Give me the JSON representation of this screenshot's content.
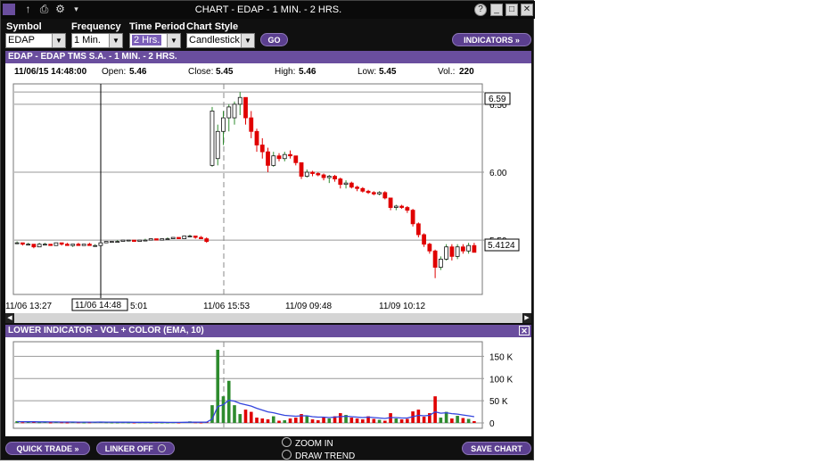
{
  "window": {
    "title": "CHART - EDAP - 1 MIN. - 2 HRS."
  },
  "toolbar": {
    "symbol_label": "Symbol",
    "symbol_value": "EDAP",
    "frequency_label": "Frequency",
    "frequency_value": "1 Min.",
    "period_label": "Time Period",
    "period_value": "2 Hrs.",
    "style_label": "Chart Style",
    "style_value": "Candlestick",
    "go_label": "GO",
    "indicators_label": "INDICATORS »"
  },
  "chart_header": "EDAP - EDAP TMS S.A. - 1 MIN. - 2 HRS.",
  "info_bar": {
    "datetime": "11/06/15 14:48:00",
    "open_label": "Open:",
    "open_value": "5.46",
    "close_label": "Close:",
    "close_value": "5.45",
    "high_label": "High:",
    "high_value": "5.46",
    "low_label": "Low:",
    "low_value": "5.45",
    "vol_label": "Vol.:",
    "vol_value": "220"
  },
  "price_chart": {
    "y_ticks": [
      "6.50",
      "6.00",
      "5.50"
    ],
    "tick_values": [
      6.5,
      6.0,
      5.5
    ],
    "high_marker": "6.59",
    "last_marker": "5.4124",
    "x_labels": [
      "11/06 13:27",
      "5:01",
      "11/06 15:53",
      "11/09 09:48",
      "11/09 10:12"
    ],
    "crosshair_label": "11/06 14:48",
    "colors": {
      "up": "#2e8b2e",
      "down": "#e00000"
    }
  },
  "lower_indicator": {
    "header": "LOWER INDICATOR - VOL + COLOR (EMA, 10)",
    "y_ticks": [
      "150 K",
      "100 K",
      "50 K",
      "0"
    ],
    "ema_color": "#3344dd"
  },
  "footer": {
    "quick_trade": "QUICK TRADE »",
    "linker": "LINKER OFF",
    "zoom_in": "ZOOM IN",
    "draw_trend": "DRAW TREND",
    "save_chart": "SAVE CHART"
  },
  "chart_data": [
    {
      "type": "candlestick",
      "title": "EDAP - EDAP TMS S.A. - 1 MIN. - 2 HRS.",
      "ylim": [
        5.1,
        6.65
      ],
      "candles": [
        [
          5.48,
          5.49,
          5.47,
          5.48
        ],
        [
          5.48,
          5.48,
          5.46,
          5.47
        ],
        [
          5.47,
          5.48,
          5.46,
          5.47
        ],
        [
          5.47,
          5.47,
          5.44,
          5.45
        ],
        [
          5.45,
          5.48,
          5.45,
          5.47
        ],
        [
          5.47,
          5.48,
          5.46,
          5.47
        ],
        [
          5.47,
          5.47,
          5.46,
          5.46
        ],
        [
          5.46,
          5.48,
          5.46,
          5.48
        ],
        [
          5.48,
          5.48,
          5.46,
          5.47
        ],
        [
          5.47,
          5.48,
          5.46,
          5.46
        ],
        [
          5.46,
          5.47,
          5.45,
          5.47
        ],
        [
          5.47,
          5.48,
          5.46,
          5.46
        ],
        [
          5.46,
          5.47,
          5.46,
          5.47
        ],
        [
          5.47,
          5.48,
          5.46,
          5.46
        ],
        [
          5.46,
          5.47,
          5.45,
          5.46
        ],
        [
          5.46,
          5.48,
          5.46,
          5.48
        ],
        [
          5.48,
          5.49,
          5.48,
          5.49
        ],
        [
          5.49,
          5.49,
          5.48,
          5.49
        ],
        [
          5.49,
          5.5,
          5.49,
          5.49
        ],
        [
          5.49,
          5.5,
          5.49,
          5.5
        ],
        [
          5.5,
          5.5,
          5.49,
          5.5
        ],
        [
          5.5,
          5.5,
          5.49,
          5.49
        ],
        [
          5.49,
          5.5,
          5.49,
          5.5
        ],
        [
          5.5,
          5.51,
          5.5,
          5.5
        ],
        [
          5.5,
          5.51,
          5.5,
          5.51
        ],
        [
          5.51,
          5.51,
          5.5,
          5.5
        ],
        [
          5.5,
          5.51,
          5.5,
          5.51
        ],
        [
          5.51,
          5.52,
          5.51,
          5.51
        ],
        [
          5.51,
          5.52,
          5.51,
          5.52
        ],
        [
          5.52,
          5.52,
          5.51,
          5.51
        ],
        [
          5.51,
          5.53,
          5.51,
          5.53
        ],
        [
          5.53,
          5.54,
          5.52,
          5.53
        ],
        [
          5.53,
          5.53,
          5.51,
          5.52
        ],
        [
          5.52,
          5.53,
          5.51,
          5.51
        ],
        [
          5.51,
          5.52,
          5.48,
          5.49
        ],
        [
          6.05,
          6.48,
          6.04,
          6.45
        ],
        [
          6.1,
          6.35,
          6.05,
          6.3
        ],
        [
          6.3,
          6.45,
          6.2,
          6.4
        ],
        [
          6.4,
          6.5,
          6.3,
          6.48
        ],
        [
          6.4,
          6.52,
          6.35,
          6.5
        ],
        [
          6.5,
          6.59,
          6.42,
          6.55
        ],
        [
          6.55,
          6.55,
          6.35,
          6.4
        ],
        [
          6.4,
          6.45,
          6.25,
          6.3
        ],
        [
          6.3,
          6.32,
          6.15,
          6.2
        ],
        [
          6.2,
          6.25,
          6.1,
          6.15
        ],
        [
          6.15,
          6.18,
          6.0,
          6.05
        ],
        [
          6.05,
          6.15,
          6.04,
          6.12
        ],
        [
          6.12,
          6.14,
          6.08,
          6.1
        ],
        [
          6.1,
          6.15,
          6.08,
          6.13
        ],
        [
          6.13,
          6.16,
          6.1,
          6.12
        ],
        [
          6.12,
          6.12,
          6.05,
          6.07
        ],
        [
          6.07,
          6.07,
          5.95,
          5.97
        ],
        [
          5.97,
          6.02,
          5.96,
          6.0
        ],
        [
          6.0,
          6.01,
          5.97,
          5.99
        ],
        [
          5.99,
          6.0,
          5.97,
          5.98
        ],
        [
          5.98,
          5.99,
          5.94,
          5.96
        ],
        [
          5.96,
          5.98,
          5.92,
          5.97
        ],
        [
          5.97,
          5.98,
          5.93,
          5.95
        ],
        [
          5.95,
          5.96,
          5.88,
          5.91
        ],
        [
          5.91,
          5.94,
          5.88,
          5.92
        ],
        [
          5.92,
          5.93,
          5.88,
          5.89
        ],
        [
          5.89,
          5.9,
          5.86,
          5.88
        ],
        [
          5.88,
          5.89,
          5.85,
          5.86
        ],
        [
          5.86,
          5.87,
          5.84,
          5.85
        ],
        [
          5.85,
          5.86,
          5.83,
          5.84
        ],
        [
          5.84,
          5.86,
          5.83,
          5.85
        ],
        [
          5.85,
          5.86,
          5.8,
          5.81
        ],
        [
          5.81,
          5.81,
          5.72,
          5.74
        ],
        [
          5.74,
          5.76,
          5.72,
          5.75
        ],
        [
          5.75,
          5.76,
          5.73,
          5.74
        ],
        [
          5.74,
          5.75,
          5.7,
          5.72
        ],
        [
          5.72,
          5.73,
          5.6,
          5.62
        ],
        [
          5.62,
          5.63,
          5.52,
          5.54
        ],
        [
          5.54,
          5.55,
          5.45,
          5.47
        ],
        [
          5.47,
          5.48,
          5.4,
          5.42
        ],
        [
          5.42,
          5.43,
          5.22,
          5.3
        ],
        [
          5.3,
          5.38,
          5.28,
          5.36
        ],
        [
          5.36,
          5.47,
          5.35,
          5.45
        ],
        [
          5.45,
          5.47,
          5.35,
          5.38
        ],
        [
          5.38,
          5.47,
          5.36,
          5.45
        ],
        [
          5.45,
          5.47,
          5.4,
          5.42
        ],
        [
          5.42,
          5.48,
          5.4,
          5.46
        ],
        [
          5.46,
          5.48,
          5.42,
          5.41
        ]
      ]
    },
    {
      "type": "bar",
      "title": "LOWER INDICATOR - VOL + COLOR (EMA, 10)",
      "ylim": [
        0,
        175000
      ],
      "values": [
        4000,
        1500,
        2000,
        3500,
        1500,
        2000,
        1000,
        2500,
        1500,
        1000,
        2000,
        1500,
        1000,
        1500,
        2000,
        3000,
        1500,
        1000,
        1000,
        1500,
        1000,
        1000,
        1500,
        1500,
        1000,
        1500,
        1000,
        1000,
        1500,
        1000,
        2000,
        3500,
        1500,
        1000,
        2000,
        40000,
        165000,
        60000,
        95000,
        40000,
        20000,
        30000,
        25000,
        12000,
        10000,
        8000,
        15000,
        5000,
        6000,
        10000,
        12000,
        20000,
        15000,
        8000,
        6000,
        12000,
        10000,
        15000,
        22000,
        18000,
        12000,
        10000,
        8000,
        15000,
        9000,
        7000,
        5000,
        22000,
        10000,
        8000,
        9000,
        26000,
        30000,
        14000,
        22000,
        60000,
        12000,
        25000,
        10000,
        16000,
        11000,
        9000,
        4000
      ],
      "ema": [
        3000,
        2800,
        2600,
        2700,
        2500,
        2400,
        2200,
        2200,
        2100,
        2000,
        2000,
        1900,
        1800,
        1800,
        1800,
        2000,
        1900,
        1800,
        1700,
        1700,
        1600,
        1500,
        1500,
        1500,
        1400,
        1400,
        1400,
        1300,
        1300,
        1300,
        1400,
        1700,
        1700,
        1600,
        1600,
        8600,
        37000,
        41000,
        51000,
        49000,
        44000,
        41000,
        38000,
        33000,
        29000,
        25000,
        23000,
        20000,
        17000,
        16000,
        15000,
        16000,
        16000,
        14000,
        13000,
        13000,
        12000,
        13000,
        14000,
        15000,
        14000,
        13000,
        12000,
        13000,
        12000,
        11000,
        10000,
        12000,
        12000,
        11000,
        11000,
        14000,
        17000,
        16000,
        17000,
        25000,
        22000,
        23000,
        21000,
        20000,
        18000,
        16000,
        14000
      ],
      "y_ticks": [
        "150 K",
        "100 K",
        "50 K",
        "0"
      ]
    }
  ]
}
